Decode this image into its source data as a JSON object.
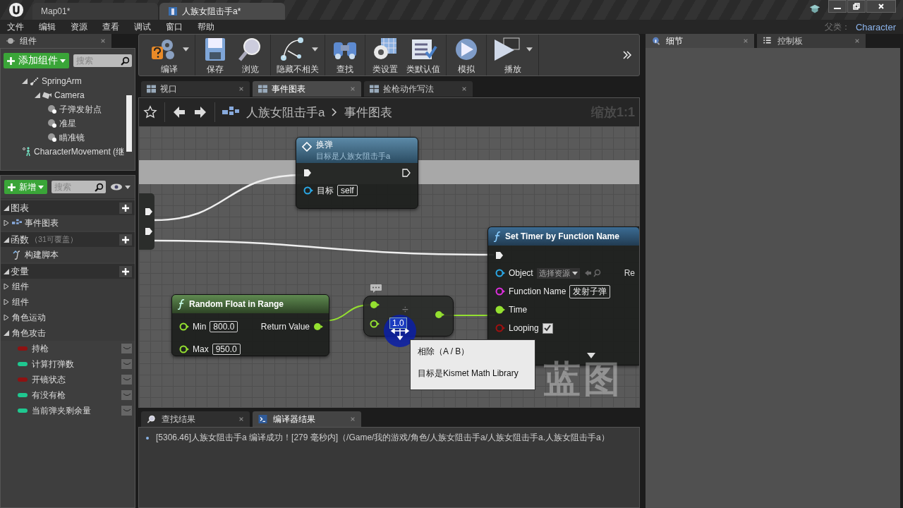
{
  "title_tabs": [
    {
      "label": "Map01*",
      "selected": false
    },
    {
      "label": "人族女阻击手a*",
      "selected": true
    }
  ],
  "menu": [
    "文件",
    "编辑",
    "资源",
    "查看",
    "调试",
    "窗口",
    "帮助"
  ],
  "parent_class": {
    "label": "父类：",
    "value": "Character"
  },
  "components_panel": {
    "tab": "组件",
    "add_button": "添加组件",
    "search_placeholder": "搜索",
    "tree": [
      {
        "label": "SpringArm",
        "kind": "arm",
        "expanded": true,
        "children": [
          {
            "label": "Camera",
            "kind": "camera",
            "expanded": true,
            "children": [
              {
                "label": "子弹发射点",
                "kind": "scene"
              },
              {
                "label": "准星",
                "kind": "scene"
              },
              {
                "label": "瞄准镜",
                "kind": "scene"
              }
            ]
          }
        ]
      },
      {
        "label": "CharacterMovement (继",
        "kind": "movement"
      }
    ]
  },
  "blueprint_panel": {
    "add_button": "新增",
    "search_placeholder": "搜索",
    "sections": [
      {
        "title": "图表",
        "items": [
          {
            "label": "事件图表",
            "kind": "graph",
            "expanded": false
          }
        ]
      },
      {
        "title": "函数",
        "note": "（31可覆盖）",
        "items": [
          {
            "label": "构建脚本",
            "kind": "function"
          }
        ]
      },
      {
        "title": "变量",
        "items": [
          {
            "label": "组件",
            "kind": "category",
            "expanded": false
          },
          {
            "label": "组件",
            "kind": "category",
            "expanded": false
          },
          {
            "label": "角色运动",
            "kind": "category",
            "expanded": false
          },
          {
            "label": "角色攻击",
            "kind": "category",
            "expanded": true,
            "children": [
              {
                "label": "持枪",
                "color": "#8e1212"
              },
              {
                "label": "计算打弹数",
                "color": "#1fc890"
              },
              {
                "label": "开镜状态",
                "color": "#8e1212"
              },
              {
                "label": "有没有枪",
                "color": "#1fc890"
              },
              {
                "label": "当前弹夹剩余量",
                "color": "#1fc890"
              }
            ]
          }
        ]
      }
    ]
  },
  "toolbar": [
    [
      {
        "label": "编译",
        "kind": "compile",
        "dropdown": true
      }
    ],
    [
      {
        "label": "保存",
        "kind": "save",
        "dropdown": false
      },
      {
        "label": "浏览",
        "kind": "browse",
        "dropdown": false
      }
    ],
    [
      {
        "label": "隐藏不相关",
        "kind": "hide",
        "dropdown": true
      }
    ],
    [
      {
        "label": "查找",
        "kind": "find",
        "dropdown": false
      }
    ],
    [
      {
        "label": "类设置",
        "kind": "settings",
        "dropdown": false
      },
      {
        "label": "类默认值",
        "kind": "defaults",
        "dropdown": false
      }
    ],
    [
      {
        "label": "模拟",
        "kind": "simulate",
        "dropdown": false
      }
    ],
    [
      {
        "label": "播放",
        "kind": "play",
        "dropdown": true
      }
    ]
  ],
  "graph_tabs": [
    {
      "label": "视口",
      "selected": false
    },
    {
      "label": "事件图表",
      "selected": true
    },
    {
      "label": "捡枪动作写法",
      "selected": false
    }
  ],
  "breadcrumb": {
    "path": [
      "人族女阻击手a",
      "事件图表"
    ],
    "zoom": "缩放1:1"
  },
  "graph": {
    "event_node": {
      "title": "换弹",
      "subtitle": "目标是人族女阻击手a",
      "pin_label": "目标",
      "pin_value": "self"
    },
    "timer_node": {
      "title": "Set Timer by Function Name",
      "output_label": "Re",
      "pins": [
        {
          "label": "Object",
          "kind": "object",
          "value": "选择资源"
        },
        {
          "label": "Function Name",
          "kind": "name",
          "value": "发射子弹"
        },
        {
          "label": "Time",
          "kind": "float"
        },
        {
          "label": "Looping",
          "kind": "bool",
          "checked": true
        }
      ]
    },
    "random_node": {
      "title": "Random Float in Range",
      "output_label": "Return Value",
      "pins": [
        {
          "label": "Min",
          "value": "800.0"
        },
        {
          "label": "Max",
          "value": "950.0"
        }
      ]
    },
    "divide_node": {
      "symbol": "÷",
      "value": "1.0"
    },
    "tooltip": {
      "title": "相除（A / B）",
      "body": "目标是Kismet Math Library"
    },
    "watermark": "蓝图"
  },
  "bottom_tabs": [
    {
      "label": "查找结果",
      "selected": false
    },
    {
      "label": "编译器结果",
      "selected": true
    }
  ],
  "log": [
    "[5306.46]人族女阻击手a 编译成功！[279 毫秒内]（/Game/我的游戏/角色/人族女阻击手a/人族女阻击手a.人族女阻击手a）"
  ],
  "details_tabs": [
    {
      "label": "细节",
      "selected": true
    },
    {
      "label": "控制板",
      "selected": false
    }
  ]
}
